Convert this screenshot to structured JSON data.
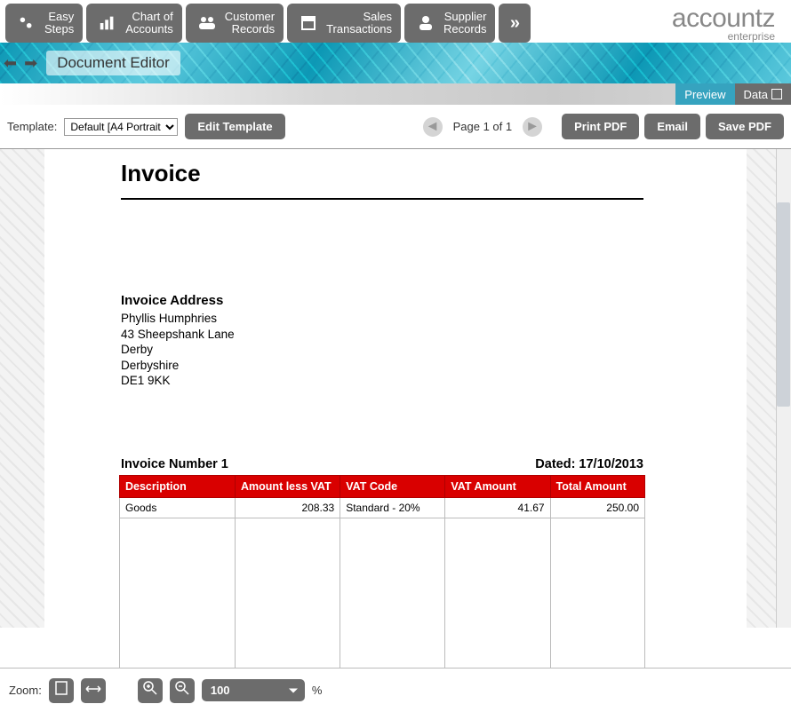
{
  "brand": {
    "name": "accountz",
    "sub": "enterprise"
  },
  "nav": [
    {
      "label": "Easy\nSteps"
    },
    {
      "label": "Chart of\nAccounts"
    },
    {
      "label": "Customer\nRecords"
    },
    {
      "label": "Sales\nTransactions"
    },
    {
      "label": "Supplier\nRecords"
    }
  ],
  "header": {
    "title": "Document Editor"
  },
  "tabs": {
    "preview": "Preview",
    "data": "Data"
  },
  "toolbar": {
    "template_label": "Template:",
    "template_value": "Default [A4 Portrait",
    "edit_template": "Edit Template",
    "page_text": "Page 1 of 1",
    "print": "Print PDF",
    "email": "Email",
    "save": "Save PDF"
  },
  "document": {
    "title": "Invoice",
    "address_heading": "Invoice Address",
    "address": [
      "Phyllis Humphries",
      "43 Sheepshank Lane",
      "Derby",
      "Derbyshire",
      "DE1 9KK"
    ],
    "invoice_no_label": "Invoice Number 1",
    "dated_label": "Dated: 17/10/2013",
    "columns": [
      "Description",
      "Amount less VAT",
      "VAT Code",
      "VAT Amount",
      "Total Amount"
    ],
    "rows": [
      {
        "desc": "Goods",
        "amount_less_vat": "208.33",
        "vat_code": "Standard - 20%",
        "vat_amount": "41.67",
        "total": "250.00"
      }
    ]
  },
  "footer": {
    "zoom_label": "Zoom:",
    "zoom_value": "100",
    "zoom_unit": "%"
  }
}
